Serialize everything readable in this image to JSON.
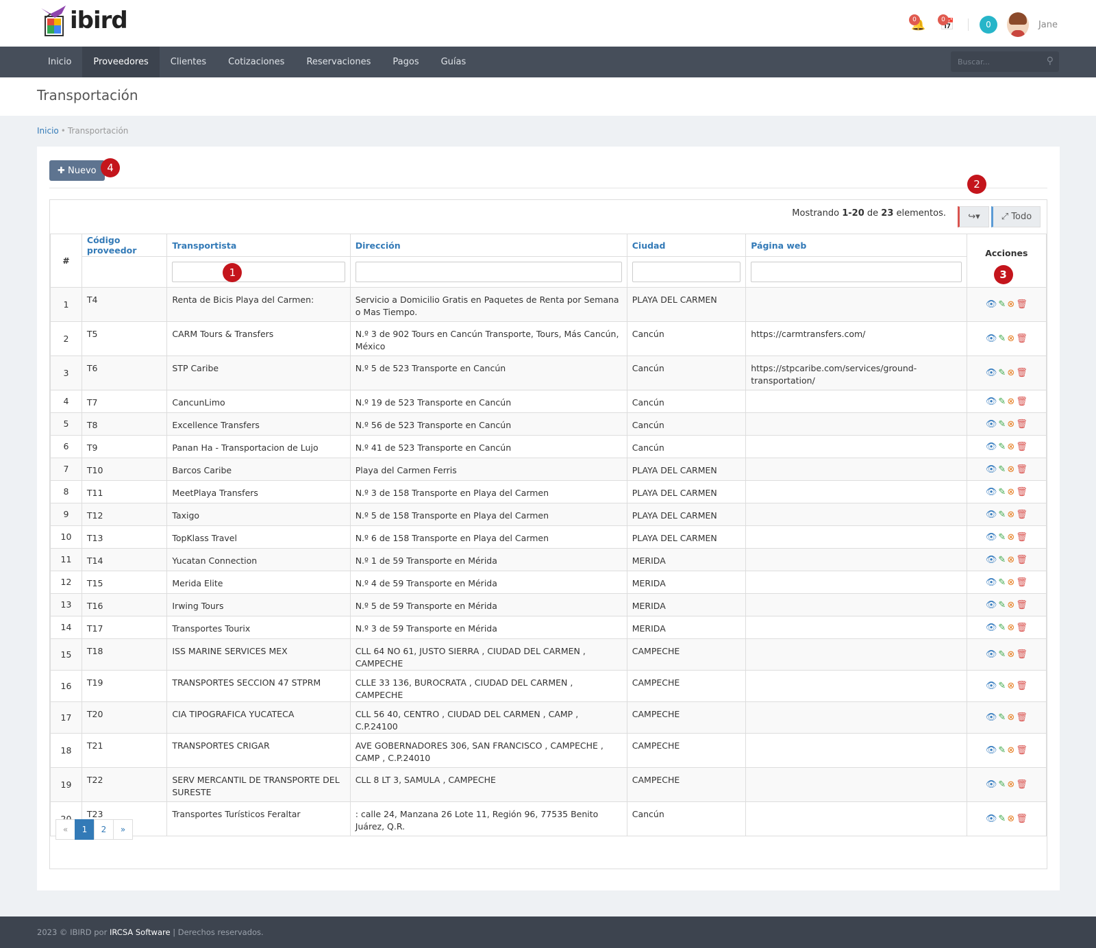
{
  "app": {
    "logo_text": "ibird"
  },
  "header": {
    "notif_count": "0",
    "calendar_count": "0",
    "cart_count": "0",
    "username": "Jane"
  },
  "nav": {
    "items": [
      "Inicio",
      "Proveedores",
      "Clientes",
      "Cotizaciones",
      "Reservaciones",
      "Pagos",
      "Guías"
    ],
    "active": "Proveedores",
    "search_placeholder": "Buscar..."
  },
  "page": {
    "title": "Transportación",
    "breadcrumb": {
      "home": "Inicio",
      "current": "Transportación"
    }
  },
  "toolbar": {
    "new_label": "Nuevo",
    "summary_prefix": "Mostrando ",
    "summary_range": "1-20",
    "summary_mid": " de ",
    "summary_total": "23",
    "summary_suffix": " elementos.",
    "all_label": "Todo"
  },
  "markers": [
    "1",
    "2",
    "3",
    "4"
  ],
  "table": {
    "headers": [
      "#",
      "Código proveedor",
      "Transportista",
      "Dirección",
      "Ciudad",
      "Página web",
      "Acciones"
    ],
    "rows": [
      [
        "1",
        "T4",
        "Renta de Bicis Playa del Carmen:",
        "Servicio a Domicilio Gratis en Paquetes de Renta por Semana o Mas Tiempo.",
        "PLAYA DEL CARMEN",
        ""
      ],
      [
        "2",
        "T5",
        "CARM Tours & Transfers",
        "N.º 3 de 902 Tours en Cancún Transporte, Tours, Más Cancún, México",
        "Cancún",
        "https://carmtransfers.com/"
      ],
      [
        "3",
        "T6",
        "STP Caribe",
        "N.º 5 de 523 Transporte en Cancún",
        "Cancún",
        "https://stpcaribe.com/services/ground-transportation/"
      ],
      [
        "4",
        "T7",
        "CancunLimo",
        "N.º 19 de 523 Transporte en Cancún",
        "Cancún",
        ""
      ],
      [
        "5",
        "T8",
        "Excellence Transfers",
        "N.º 56 de 523 Transporte en Cancún",
        "Cancún",
        ""
      ],
      [
        "6",
        "T9",
        "Panan Ha - Transportacion de Lujo",
        "N.º 41 de 523 Transporte en Cancún",
        "Cancún",
        ""
      ],
      [
        "7",
        "T10",
        "Barcos Caribe",
        "Playa del Carmen Ferris",
        "PLAYA DEL CARMEN",
        ""
      ],
      [
        "8",
        "T11",
        "MeetPlaya Transfers",
        "N.º 3 de 158 Transporte en Playa del Carmen",
        "PLAYA DEL CARMEN",
        ""
      ],
      [
        "9",
        "T12",
        "Taxigo",
        "N.º 5 de 158 Transporte en Playa del Carmen",
        "PLAYA DEL CARMEN",
        ""
      ],
      [
        "10",
        "T13",
        "TopKlass Travel",
        "N.º 6 de 158 Transporte en Playa del Carmen",
        "PLAYA DEL CARMEN",
        ""
      ],
      [
        "11",
        "T14",
        "Yucatan Connection",
        "N.º 1 de 59 Transporte en Mérida",
        "MERIDA",
        ""
      ],
      [
        "12",
        "T15",
        "Merida Elite",
        "N.º 4 de 59 Transporte en Mérida",
        "MERIDA",
        ""
      ],
      [
        "13",
        "T16",
        "Irwing Tours",
        "N.º 5 de 59 Transporte en Mérida",
        "MERIDA",
        ""
      ],
      [
        "14",
        "T17",
        "Transportes Tourix",
        "N.º 3 de 59 Transporte en Mérida",
        "MERIDA",
        ""
      ],
      [
        "15",
        "T18",
        "ISS MARINE SERVICES MEX",
        "CLL 64 NO 61, JUSTO SIERRA , CIUDAD DEL CARMEN , CAMPECHE",
        "CAMPECHE",
        ""
      ],
      [
        "16",
        "T19",
        "TRANSPORTES SECCION 47 STPRM",
        "CLLE 33 136, BUROCRATA , CIUDAD DEL CARMEN , CAMPECHE",
        "CAMPECHE",
        ""
      ],
      [
        "17",
        "T20",
        "CIA TIPOGRAFICA YUCATECA",
        "CLL 56 40, CENTRO , CIUDAD DEL CARMEN , CAMP , C.P.24100",
        "CAMPECHE",
        ""
      ],
      [
        "18",
        "T21",
        "TRANSPORTES CRIGAR",
        "AVE GOBERNADORES 306, SAN FRANCISCO , CAMPECHE , CAMP , C.P.24010",
        "CAMPECHE",
        ""
      ],
      [
        "19",
        "T22",
        "SERV MERCANTIL DE TRANSPORTE DEL SURESTE",
        "CLL 8 LT 3, SAMULA , CAMPECHE",
        "CAMPECHE",
        ""
      ],
      [
        "20",
        "T23",
        "Transportes Turísticos Feraltar",
        ": calle 24, Manzana 26 Lote 11, Región 96, 77535 Benito Juárez, Q.R.",
        "Cancún",
        ""
      ]
    ]
  },
  "pagination": {
    "prev": "«",
    "pages": [
      "1",
      "2"
    ],
    "current": "1",
    "next": "»"
  },
  "footer": {
    "copyright": "2023 © IBIRD por ",
    "brand": "IRCSA Software",
    "sep": " | ",
    "rights": "Derechos reservados."
  },
  "colors": {
    "nav_bg": "#464e5a",
    "primary": "#337ab7",
    "marker": "#c4151c",
    "button": "#5e7490"
  }
}
